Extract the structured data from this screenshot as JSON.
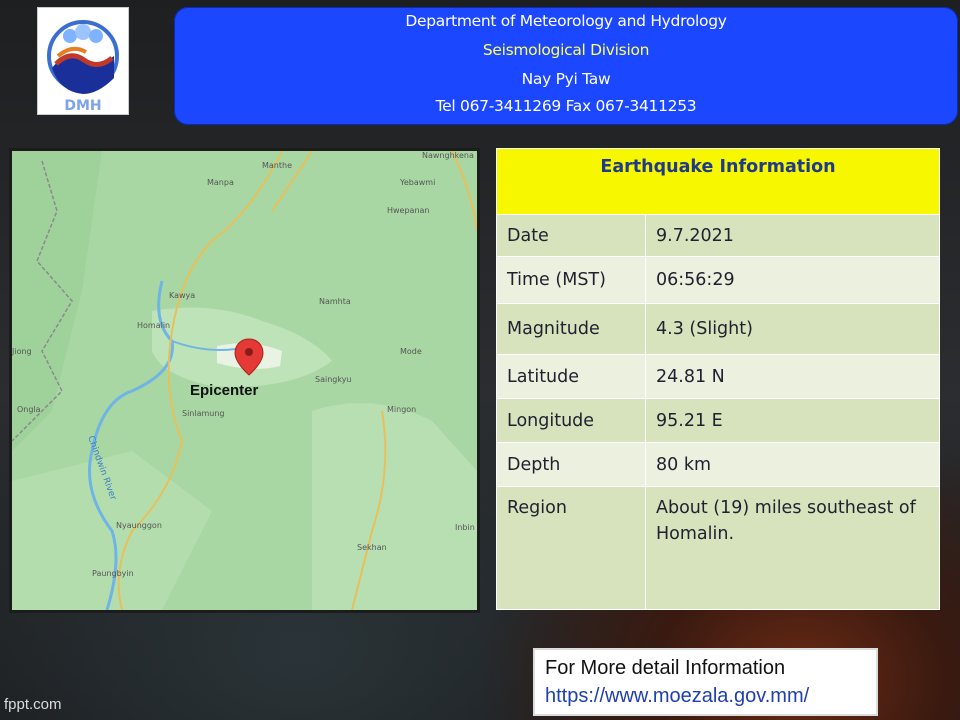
{
  "logo": {
    "text": "DMH"
  },
  "header": {
    "line1": "Department of Meteorology and Hydrology",
    "line2": "Seismological Division",
    "line3": "Nay Pyi Taw",
    "line4": "Tel 067-3411269 Fax 067-3411253",
    "background_color": "#1a47ff"
  },
  "map": {
    "epicenter_label": "Epicenter",
    "river_label": "Chindwin River",
    "places": {
      "manthe": "Manthe",
      "nawnghkena": "Nawnghkena",
      "manpa": "Manpa",
      "yebawmi": "Yebawmi",
      "hwepanan": "Hwepanan",
      "kawya": "Kawya",
      "namhta": "Namhta",
      "homalin": "Homalin",
      "mode": "Mode",
      "jiong": "Jiong",
      "saingkyu": "Saingkyu",
      "ongla": "Ongla",
      "sinlamung": "Sinlamung",
      "mingon": "Mingon",
      "sekhan": "Sekhan",
      "inbin": "Inbin",
      "nyaunggon": "Nyaunggon",
      "paungbyin": "Paungbyin"
    }
  },
  "info": {
    "title": "Earthquake Information",
    "rows": [
      {
        "key": "Date",
        "value": "9.7.2021"
      },
      {
        "key": "Time (MST)",
        "value": "06:56:29"
      },
      {
        "key": "Magnitude",
        "value": "4.3 (Slight)"
      },
      {
        "key": "Latitude",
        "value": "24.81 N"
      },
      {
        "key": "Longitude",
        "value": "95.21 E"
      },
      {
        "key": "Depth",
        "value": "80 km"
      },
      {
        "key": "Region",
        "value": "About (19) miles southeast of Homalin."
      }
    ]
  },
  "more": {
    "line1": "For More detail Information",
    "link": "https://www.moezala.gov.mm/"
  },
  "footer": {
    "brand": "fppt.com"
  }
}
